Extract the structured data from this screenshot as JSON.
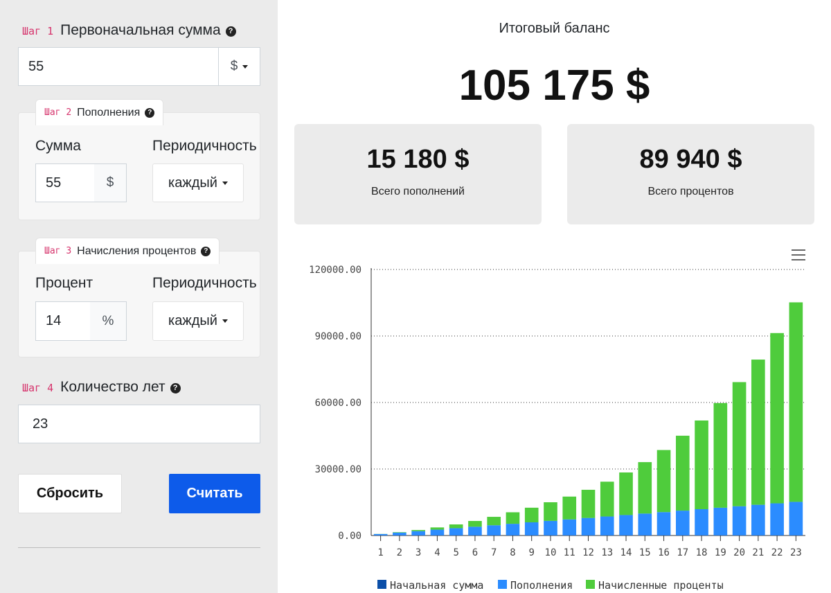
{
  "form": {
    "step_word": "Шаг",
    "step1": {
      "num": "1",
      "title": "Первоначальная сумма",
      "value": "55",
      "currency": "$"
    },
    "step2": {
      "num": "2",
      "title": "Пополнения",
      "amount_label": "Сумма",
      "amount_value": "55",
      "amount_unit": "$",
      "period_label": "Периодичность",
      "period_value": "каждый"
    },
    "step3": {
      "num": "3",
      "title": "Начисления процентов",
      "rate_label": "Процент",
      "rate_value": "14",
      "rate_unit": "%",
      "period_label": "Периодичность",
      "period_value": "каждый"
    },
    "step4": {
      "num": "4",
      "title": "Количество лет",
      "value": "23"
    },
    "reset_label": "Сбросить",
    "calc_label": "Считать",
    "help_glyph": "?"
  },
  "result": {
    "balance_label": "Итоговый баланс",
    "balance_value": "105 175 $",
    "total_contrib_value": "15 180 $",
    "total_contrib_label": "Всего пополнений",
    "total_interest_value": "89 940 $",
    "total_interest_label": "Всего процентов"
  },
  "chart_data": {
    "type": "bar",
    "stacked": true,
    "categories": [
      "1",
      "2",
      "3",
      "4",
      "5",
      "6",
      "7",
      "8",
      "9",
      "10",
      "11",
      "12",
      "13",
      "14",
      "15",
      "16",
      "17",
      "18",
      "19",
      "20",
      "21",
      "22",
      "23"
    ],
    "ylim": [
      0,
      120000
    ],
    "yticks": [
      "0.00",
      "30000.00",
      "60000.00",
      "90000.00",
      "120000.00"
    ],
    "grid": true,
    "legend_position": "bottom",
    "series": [
      {
        "name": "Начальная сумма",
        "color": "#0b4fa8",
        "values": [
          55,
          55,
          55,
          55,
          55,
          55,
          55,
          55,
          55,
          55,
          55,
          55,
          55,
          55,
          55,
          55,
          55,
          55,
          55,
          55,
          55,
          55,
          55
        ]
      },
      {
        "name": "Пополнения",
        "color": "#2b8cff",
        "values": [
          605,
          1265,
          1925,
          2585,
          3245,
          3905,
          4565,
          5225,
          5885,
          6545,
          7205,
          7865,
          8525,
          9185,
          9845,
          10505,
          11165,
          11825,
          12485,
          13145,
          13805,
          14465,
          15125
        ]
      },
      {
        "name": "Начисленные проценты",
        "color": "#4fcc3c",
        "values": [
          45,
          200,
          500,
          1000,
          1700,
          2600,
          3800,
          5200,
          6600,
          8400,
          10300,
          12700,
          15700,
          19200,
          23200,
          28000,
          33800,
          40000,
          47200,
          56000,
          65500,
          76800,
          89995
        ]
      }
    ]
  }
}
